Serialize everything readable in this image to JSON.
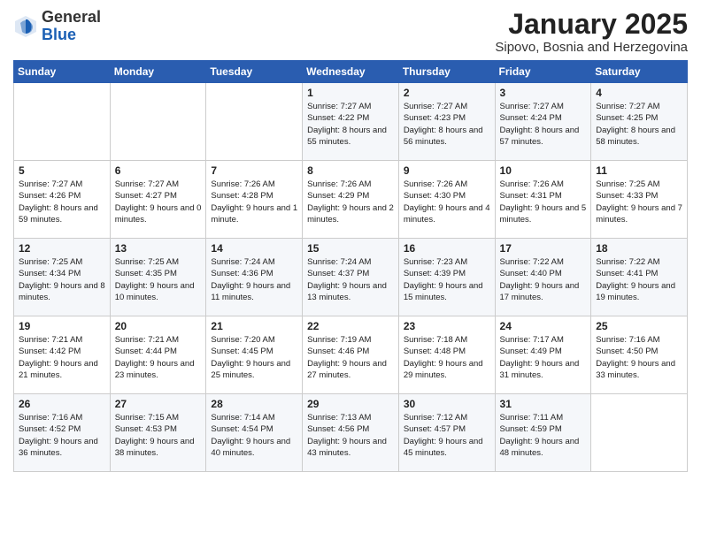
{
  "logo": {
    "general": "General",
    "blue": "Blue"
  },
  "title": "January 2025",
  "subtitle": "Sipovo, Bosnia and Herzegovina",
  "weekdays": [
    "Sunday",
    "Monday",
    "Tuesday",
    "Wednesday",
    "Thursday",
    "Friday",
    "Saturday"
  ],
  "weeks": [
    [
      {
        "day": "",
        "sunrise": "",
        "sunset": "",
        "daylight": ""
      },
      {
        "day": "",
        "sunrise": "",
        "sunset": "",
        "daylight": ""
      },
      {
        "day": "",
        "sunrise": "",
        "sunset": "",
        "daylight": ""
      },
      {
        "day": "1",
        "sunrise": "Sunrise: 7:27 AM",
        "sunset": "Sunset: 4:22 PM",
        "daylight": "Daylight: 8 hours and 55 minutes."
      },
      {
        "day": "2",
        "sunrise": "Sunrise: 7:27 AM",
        "sunset": "Sunset: 4:23 PM",
        "daylight": "Daylight: 8 hours and 56 minutes."
      },
      {
        "day": "3",
        "sunrise": "Sunrise: 7:27 AM",
        "sunset": "Sunset: 4:24 PM",
        "daylight": "Daylight: 8 hours and 57 minutes."
      },
      {
        "day": "4",
        "sunrise": "Sunrise: 7:27 AM",
        "sunset": "Sunset: 4:25 PM",
        "daylight": "Daylight: 8 hours and 58 minutes."
      }
    ],
    [
      {
        "day": "5",
        "sunrise": "Sunrise: 7:27 AM",
        "sunset": "Sunset: 4:26 PM",
        "daylight": "Daylight: 8 hours and 59 minutes."
      },
      {
        "day": "6",
        "sunrise": "Sunrise: 7:27 AM",
        "sunset": "Sunset: 4:27 PM",
        "daylight": "Daylight: 9 hours and 0 minutes."
      },
      {
        "day": "7",
        "sunrise": "Sunrise: 7:26 AM",
        "sunset": "Sunset: 4:28 PM",
        "daylight": "Daylight: 9 hours and 1 minute."
      },
      {
        "day": "8",
        "sunrise": "Sunrise: 7:26 AM",
        "sunset": "Sunset: 4:29 PM",
        "daylight": "Daylight: 9 hours and 2 minutes."
      },
      {
        "day": "9",
        "sunrise": "Sunrise: 7:26 AM",
        "sunset": "Sunset: 4:30 PM",
        "daylight": "Daylight: 9 hours and 4 minutes."
      },
      {
        "day": "10",
        "sunrise": "Sunrise: 7:26 AM",
        "sunset": "Sunset: 4:31 PM",
        "daylight": "Daylight: 9 hours and 5 minutes."
      },
      {
        "day": "11",
        "sunrise": "Sunrise: 7:25 AM",
        "sunset": "Sunset: 4:33 PM",
        "daylight": "Daylight: 9 hours and 7 minutes."
      }
    ],
    [
      {
        "day": "12",
        "sunrise": "Sunrise: 7:25 AM",
        "sunset": "Sunset: 4:34 PM",
        "daylight": "Daylight: 9 hours and 8 minutes."
      },
      {
        "day": "13",
        "sunrise": "Sunrise: 7:25 AM",
        "sunset": "Sunset: 4:35 PM",
        "daylight": "Daylight: 9 hours and 10 minutes."
      },
      {
        "day": "14",
        "sunrise": "Sunrise: 7:24 AM",
        "sunset": "Sunset: 4:36 PM",
        "daylight": "Daylight: 9 hours and 11 minutes."
      },
      {
        "day": "15",
        "sunrise": "Sunrise: 7:24 AM",
        "sunset": "Sunset: 4:37 PM",
        "daylight": "Daylight: 9 hours and 13 minutes."
      },
      {
        "day": "16",
        "sunrise": "Sunrise: 7:23 AM",
        "sunset": "Sunset: 4:39 PM",
        "daylight": "Daylight: 9 hours and 15 minutes."
      },
      {
        "day": "17",
        "sunrise": "Sunrise: 7:22 AM",
        "sunset": "Sunset: 4:40 PM",
        "daylight": "Daylight: 9 hours and 17 minutes."
      },
      {
        "day": "18",
        "sunrise": "Sunrise: 7:22 AM",
        "sunset": "Sunset: 4:41 PM",
        "daylight": "Daylight: 9 hours and 19 minutes."
      }
    ],
    [
      {
        "day": "19",
        "sunrise": "Sunrise: 7:21 AM",
        "sunset": "Sunset: 4:42 PM",
        "daylight": "Daylight: 9 hours and 21 minutes."
      },
      {
        "day": "20",
        "sunrise": "Sunrise: 7:21 AM",
        "sunset": "Sunset: 4:44 PM",
        "daylight": "Daylight: 9 hours and 23 minutes."
      },
      {
        "day": "21",
        "sunrise": "Sunrise: 7:20 AM",
        "sunset": "Sunset: 4:45 PM",
        "daylight": "Daylight: 9 hours and 25 minutes."
      },
      {
        "day": "22",
        "sunrise": "Sunrise: 7:19 AM",
        "sunset": "Sunset: 4:46 PM",
        "daylight": "Daylight: 9 hours and 27 minutes."
      },
      {
        "day": "23",
        "sunrise": "Sunrise: 7:18 AM",
        "sunset": "Sunset: 4:48 PM",
        "daylight": "Daylight: 9 hours and 29 minutes."
      },
      {
        "day": "24",
        "sunrise": "Sunrise: 7:17 AM",
        "sunset": "Sunset: 4:49 PM",
        "daylight": "Daylight: 9 hours and 31 minutes."
      },
      {
        "day": "25",
        "sunrise": "Sunrise: 7:16 AM",
        "sunset": "Sunset: 4:50 PM",
        "daylight": "Daylight: 9 hours and 33 minutes."
      }
    ],
    [
      {
        "day": "26",
        "sunrise": "Sunrise: 7:16 AM",
        "sunset": "Sunset: 4:52 PM",
        "daylight": "Daylight: 9 hours and 36 minutes."
      },
      {
        "day": "27",
        "sunrise": "Sunrise: 7:15 AM",
        "sunset": "Sunset: 4:53 PM",
        "daylight": "Daylight: 9 hours and 38 minutes."
      },
      {
        "day": "28",
        "sunrise": "Sunrise: 7:14 AM",
        "sunset": "Sunset: 4:54 PM",
        "daylight": "Daylight: 9 hours and 40 minutes."
      },
      {
        "day": "29",
        "sunrise": "Sunrise: 7:13 AM",
        "sunset": "Sunset: 4:56 PM",
        "daylight": "Daylight: 9 hours and 43 minutes."
      },
      {
        "day": "30",
        "sunrise": "Sunrise: 7:12 AM",
        "sunset": "Sunset: 4:57 PM",
        "daylight": "Daylight: 9 hours and 45 minutes."
      },
      {
        "day": "31",
        "sunrise": "Sunrise: 7:11 AM",
        "sunset": "Sunset: 4:59 PM",
        "daylight": "Daylight: 9 hours and 48 minutes."
      },
      {
        "day": "",
        "sunrise": "",
        "sunset": "",
        "daylight": ""
      }
    ]
  ]
}
